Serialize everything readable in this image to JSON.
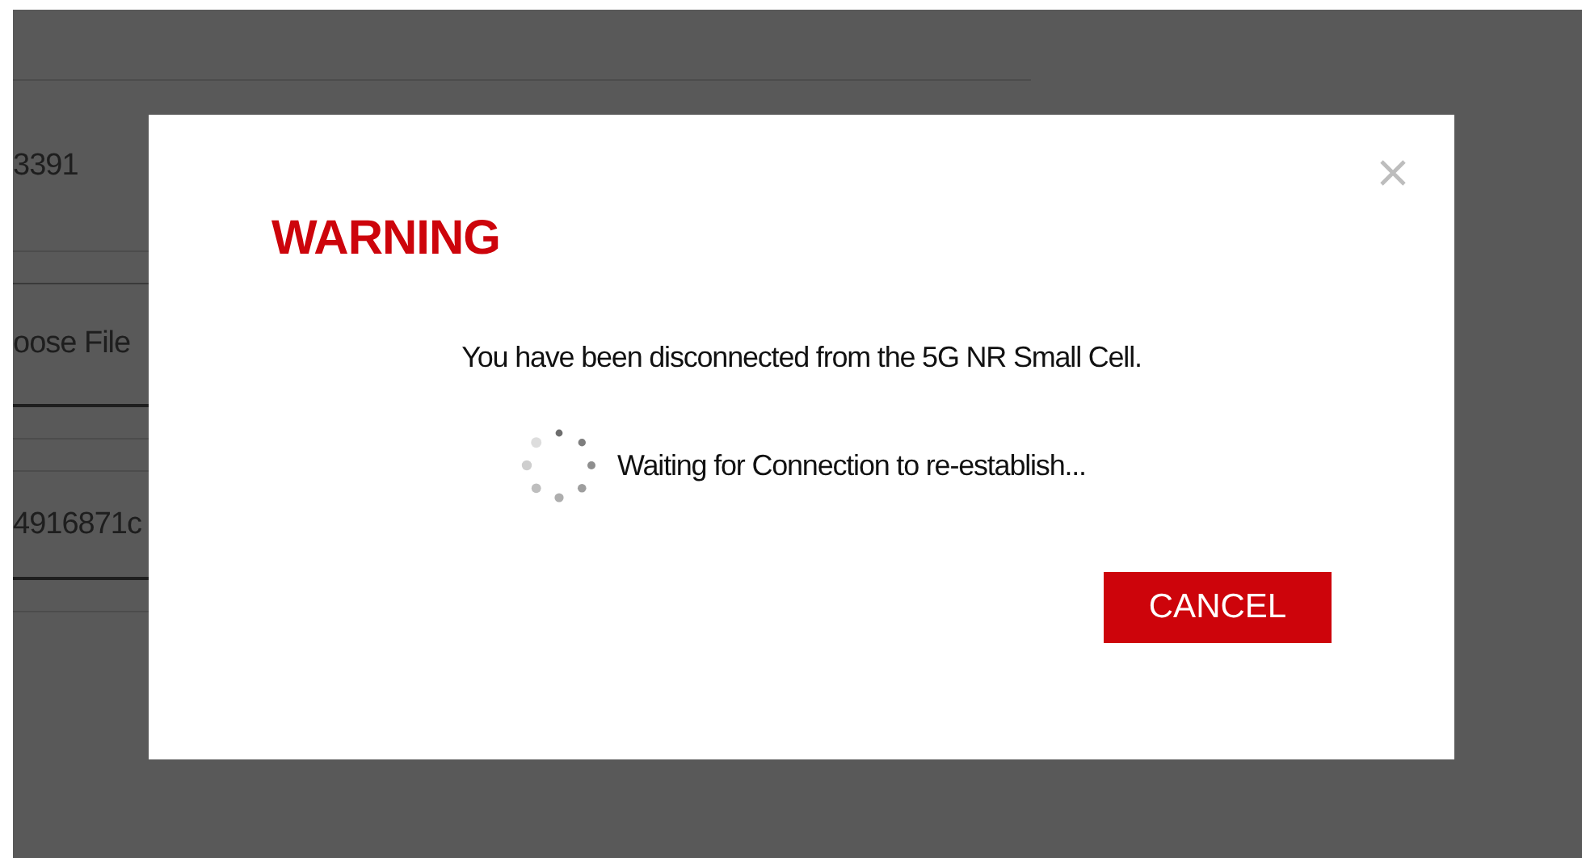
{
  "background": {
    "rows": [
      {
        "kind": "text",
        "value": "3391"
      },
      {
        "kind": "field",
        "value": "oose File"
      },
      {
        "kind": "field",
        "value": "4916871c"
      }
    ]
  },
  "dialog": {
    "title": "WARNING",
    "message": "You have been disconnected from the 5G NR Small Cell.",
    "status": "Waiting for Connection to re-establish...",
    "buttons": [
      "CANCEL"
    ]
  }
}
